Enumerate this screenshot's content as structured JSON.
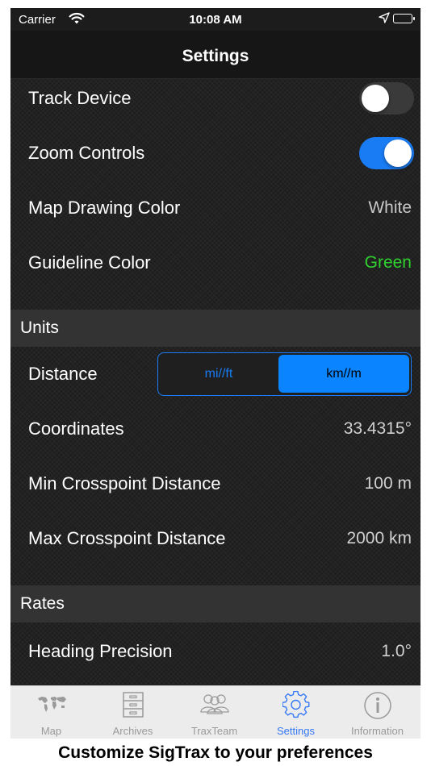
{
  "status_bar": {
    "carrier": "Carrier",
    "time": "10:08 AM"
  },
  "nav": {
    "title": "Settings"
  },
  "rows": {
    "track_device": {
      "label": "Track Device",
      "on": false
    },
    "zoom_controls": {
      "label": "Zoom Controls",
      "on": true
    },
    "map_drawing_color": {
      "label": "Map Drawing Color",
      "value": "White"
    },
    "guideline_color": {
      "label": "Guideline Color",
      "value": "Green"
    }
  },
  "units": {
    "header": "Units",
    "distance": {
      "label": "Distance",
      "options": [
        "mi//ft",
        "km//m"
      ],
      "selected": "km//m"
    },
    "coordinates": {
      "label": "Coordinates",
      "value": "33.4315°"
    },
    "min_crosspoint": {
      "label": "Min Crosspoint Distance",
      "value": "100 m"
    },
    "max_crosspoint": {
      "label": "Max Crosspoint Distance",
      "value": "2000 km"
    }
  },
  "rates": {
    "header": "Rates",
    "heading_precision": {
      "label": "Heading Precision",
      "value": "1.0°"
    }
  },
  "tab_bar": {
    "tabs": [
      {
        "label": "Map",
        "icon": "world-map-icon"
      },
      {
        "label": "Archives",
        "icon": "file-cabinet-icon"
      },
      {
        "label": "TraxTeam",
        "icon": "people-group-icon"
      },
      {
        "label": "Settings",
        "icon": "gear-icon"
      },
      {
        "label": "Information",
        "icon": "info-icon"
      }
    ],
    "active": "Settings"
  },
  "colors": {
    "accent": "#1a7cf5",
    "guideline_green": "#2fd22f",
    "tab_active": "#3478f6"
  },
  "caption": "Customize SigTrax to your preferences"
}
